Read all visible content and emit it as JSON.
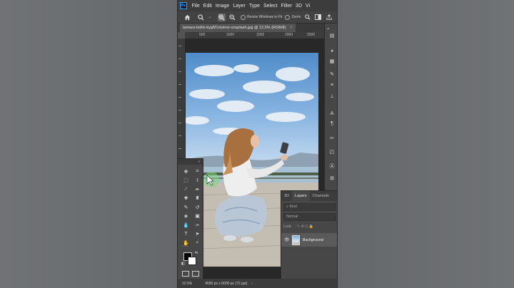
{
  "app": {
    "logo": "Ps",
    "menu": [
      "File",
      "Edit",
      "Image",
      "Layer",
      "Type",
      "Select",
      "Filter",
      "3D",
      "Vi"
    ]
  },
  "options_bar": {
    "icons": [
      "home-icon",
      "zoom-icon",
      "chevron-down-icon",
      "zoom-in-icon",
      "zoom-out-icon"
    ],
    "resize_windows_label": "Resize Windows to Fit",
    "zoom_all_label": "Zoom"
  },
  "document": {
    "tab_title": "tamara-bellis-kyg5f1vluhne-unsplash.jpg @ 12.5% (RGB/8)",
    "close": "×"
  },
  "ruler": {
    "top_ticks": [
      "500",
      "1000",
      "1500",
      "2000",
      "2500"
    ]
  },
  "layers_panel": {
    "tabs": [
      "3D",
      "Layers",
      "Channels"
    ],
    "active_tab": "Layers",
    "search_placeholder": "Kind",
    "blend_mode": "Normal",
    "lock_label": "Lock:",
    "layers": [
      {
        "name": "Background",
        "visible": true
      }
    ]
  },
  "tools_panel": {
    "more": "···"
  },
  "status": {
    "zoom": "12.5%",
    "doc_info": "4000 px x 6000 px (72 ppi)"
  },
  "colors": {
    "foreground": "#000000",
    "background": "#ffffff",
    "ui_dark": "#3c3c3c",
    "ui_mid": "#535353"
  }
}
